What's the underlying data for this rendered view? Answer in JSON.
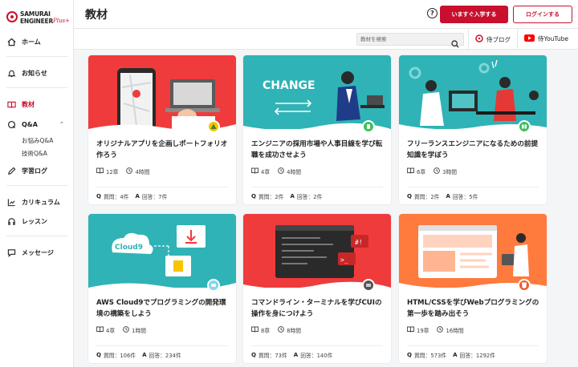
{
  "logo": {
    "line1": "SAMURAI",
    "line2": "ENGINEER",
    "plus": "Plus+"
  },
  "header": {
    "title": "教材",
    "help": "?",
    "join_button": "いますぐ入学する",
    "login_button": "ログインする"
  },
  "subheader": {
    "search_placeholder": "教材を検索",
    "blog_link": "侍ブログ",
    "youtube_link": "侍YouTube"
  },
  "sidebar": {
    "home": "ホーム",
    "news": "お知らせ",
    "materials": "教材",
    "qa": "Q&A",
    "qa_sub1": "お悩みQ&A",
    "qa_sub2": "技術Q&A",
    "log": "学習ログ",
    "curriculum": "カリキュラム",
    "lesson": "レッスン",
    "message": "メッセージ"
  },
  "qa_labels": {
    "q": "Q",
    "a": "A"
  },
  "colors": {
    "brand": "#c8102e",
    "teal": "#2fb3b6",
    "orange": "#ff7a3d",
    "red": "#ef3b3b"
  },
  "cards": [
    {
      "title": "オリジナルアプリを企画しポートフォリオ作ろう",
      "chapters": "12章",
      "time": "4時間",
      "questions": "質問：4件",
      "answers": "回答：7件"
    },
    {
      "title": "エンジニアの採用市場や人事目線を学び転職を成功させよう",
      "chapters": "4章",
      "time": "4時間",
      "questions": "質問：2件",
      "answers": "回答：2件"
    },
    {
      "title": "フリーランスエンジニアになるための前提知識を学ぼう",
      "chapters": "6章",
      "time": "3時間",
      "questions": "質問：2件",
      "answers": "回答：5件"
    },
    {
      "title": "AWS Cloud9でプログラミングの開発環境の構築をしよう",
      "chapters": "4章",
      "time": "1時間",
      "questions": "質問：106件",
      "answers": "回答：234件"
    },
    {
      "title": "コマンドライン・ターミナルを学びCUIの操作を身につけよう",
      "chapters": "8章",
      "time": "8時間",
      "questions": "質問：73件",
      "answers": "回答：140件"
    },
    {
      "title": "HTML/CSSを学びWebプログラミングの第一歩を踏み出そう",
      "chapters": "19章",
      "time": "16時間",
      "questions": "質問：573件",
      "answers": "回答：1292件"
    }
  ],
  "thumb_text": {
    "change": "CHANGE",
    "cloud9": "Cloud9",
    "hash": "#!",
    "prompt": ">_"
  }
}
